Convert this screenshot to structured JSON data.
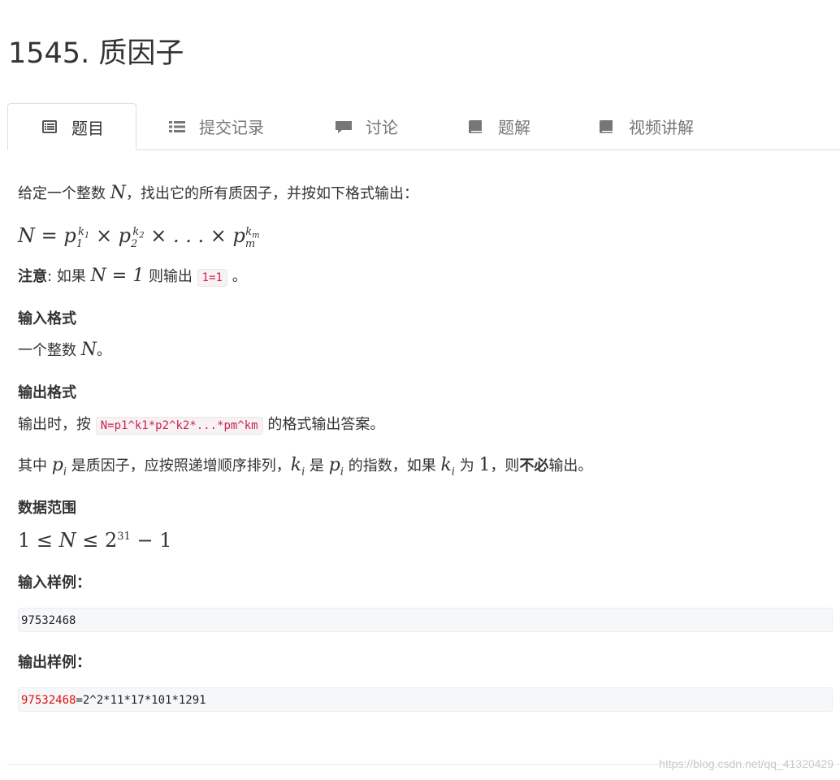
{
  "problem": {
    "title": "1545. 质因子"
  },
  "tabs": [
    {
      "label": "题目",
      "icon": "list-alt-icon",
      "active": true
    },
    {
      "label": "提交记录",
      "icon": "list-icon",
      "active": false
    },
    {
      "label": "讨论",
      "icon": "comment-icon",
      "active": false
    },
    {
      "label": "题解",
      "icon": "book-icon",
      "active": false
    },
    {
      "label": "视频讲解",
      "icon": "book-icon",
      "active": false
    }
  ],
  "body": {
    "intro_pre": "给定一个整数",
    "intro_var": "N",
    "intro_post": "，找出它的所有质因子，并按如下格式输出：",
    "note_label": "注意",
    "note_pre": ": 如果",
    "note_math": "N = 1",
    "note_mid": "则输出",
    "note_code": "1=1",
    "note_post": "。",
    "input_format_title": "输入格式",
    "input_format_pre": "一个整数",
    "input_format_var": "N",
    "input_format_post": "。",
    "output_format_title": "输出格式",
    "output_format_pre": "输出时，按",
    "output_format_code": "N=p1^k1*p2^k2*...*pm^km",
    "output_format_post": "的格式输出答案。",
    "detail_1": "其中",
    "detail_2": "是质因子，应按照递增顺序排列，",
    "detail_3": "是",
    "detail_4": "的指数，如果",
    "detail_5": "为",
    "detail_one": "1",
    "detail_6": "，则",
    "detail_bold": "不必",
    "detail_7": "输出。",
    "range_title": "数据范围",
    "sample_input_title": "输入样例：",
    "sample_input": "97532468",
    "sample_output_title": "输出样例：",
    "sample_output_highlight": "97532468",
    "sample_output_rest": "=2^2*11*17*101*1291"
  },
  "watermark": "https://blog.csdn.net/qq_41320429"
}
